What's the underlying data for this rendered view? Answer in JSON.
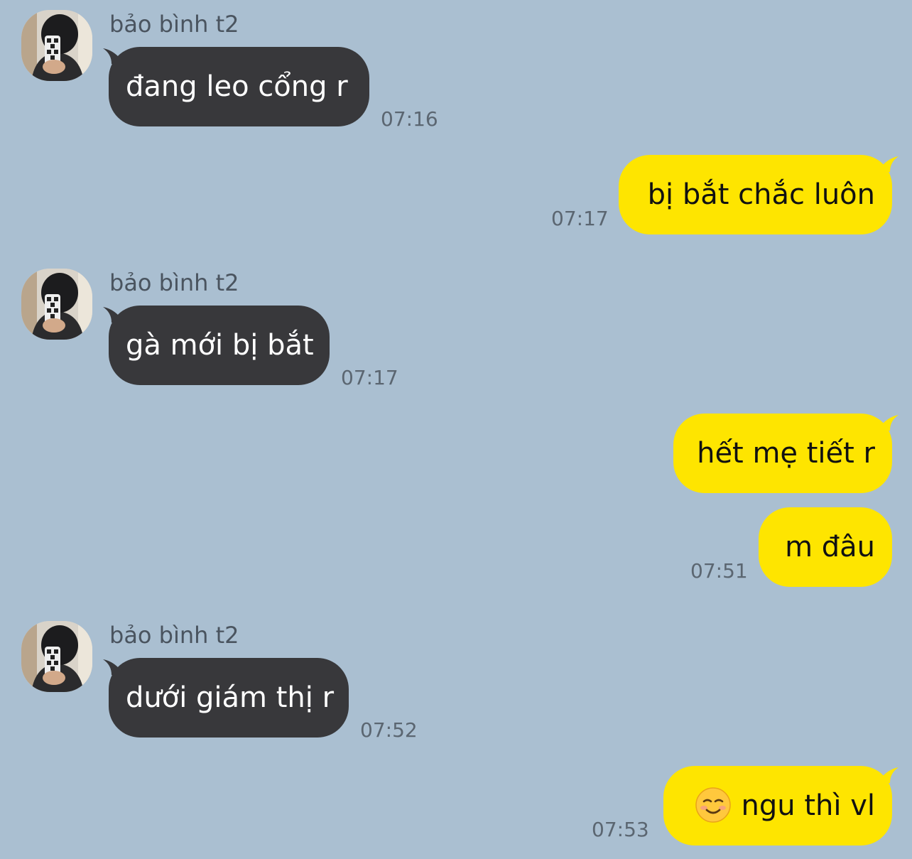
{
  "colors": {
    "background": "#aabfd1",
    "incoming_bubble": "#38383b",
    "outgoing_bubble": "#fee500"
  },
  "messages": [
    {
      "direction": "in",
      "sender": "bảo bình t2",
      "text": "đang leo cổng r",
      "time": "07:16"
    },
    {
      "direction": "out",
      "text": "bị bắt chắc luôn",
      "time": "07:17"
    },
    {
      "direction": "in",
      "sender": "bảo bình t2",
      "text": "gà mới bị bắt",
      "time": "07:17"
    },
    {
      "direction": "out",
      "text": "hết mẹ tiết r",
      "time": ""
    },
    {
      "direction": "out",
      "text": "m đâu",
      "time": "07:51"
    },
    {
      "direction": "in",
      "sender": "bảo bình t2",
      "text": "dưới giám thị r",
      "time": "07:52"
    },
    {
      "direction": "out",
      "emoji": "smiling-face-icon",
      "text": "ngu thì vl",
      "time": "07:53"
    }
  ]
}
